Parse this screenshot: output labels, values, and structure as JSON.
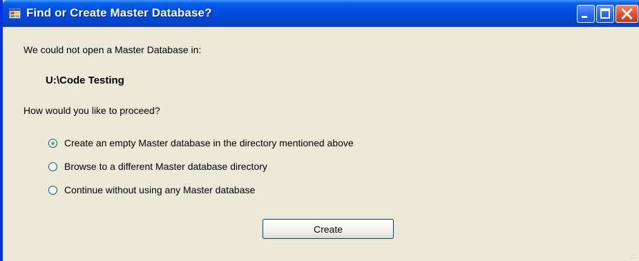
{
  "window": {
    "title": "Find or Create Master Database?",
    "icon": "app-window-icon",
    "controls": [
      "minimize-icon",
      "maximize-icon",
      "close-icon"
    ]
  },
  "dialog": {
    "intro": "We could not open a Master Database in:",
    "path": "U:\\Code Testing",
    "question": "How would you like to proceed?",
    "options": [
      {
        "label": "Create an empty Master database in the directory mentioned above",
        "checked": true
      },
      {
        "label": "Browse to a different Master database directory",
        "checked": false
      },
      {
        "label": "Continue without using any Master database",
        "checked": false
      }
    ],
    "button_label": "Create"
  },
  "colors": {
    "titlebar": "#0054e3",
    "window_border": "#0831d9",
    "client_bg": "#ece9d8",
    "close_button": "#e0522c",
    "radio_dot": "#21a121"
  }
}
